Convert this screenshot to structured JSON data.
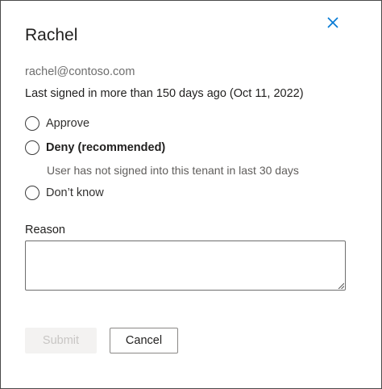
{
  "dialog": {
    "title": "Rachel",
    "close_icon": "close-icon",
    "email": "rachel@contoso.com",
    "last_signed_in": "Last signed in more than 150 days ago (Oct 11, 2022)"
  },
  "options": [
    {
      "label": "Approve",
      "selected": false
    },
    {
      "label": "Deny (recommended)",
      "description": "User has not signed into this tenant in last 30 days",
      "selected": false
    },
    {
      "label": "Don’t know",
      "selected": false
    }
  ],
  "reason": {
    "label": "Reason",
    "value": ""
  },
  "buttons": {
    "submit_label": "Submit",
    "submit_disabled": true,
    "cancel_label": "Cancel"
  },
  "colors": {
    "accent": "#0078d4",
    "border": "#4a4a4a",
    "disabled_bg": "#f3f2f1",
    "disabled_text": "#c8c6c4"
  }
}
